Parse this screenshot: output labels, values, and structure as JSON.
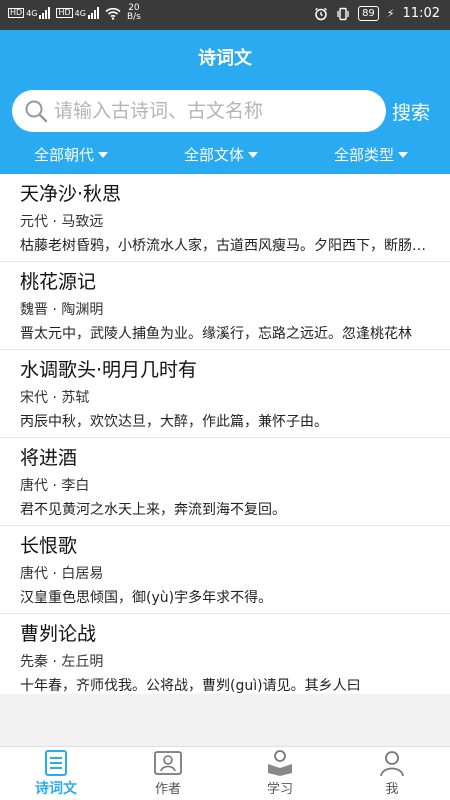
{
  "status_bar": {
    "sim1": "HD",
    "sim2": "HD",
    "net1": "4G",
    "net2": "4G",
    "speed_value": "20",
    "speed_unit": "B/s",
    "battery": "89",
    "time": "11:02"
  },
  "header": {
    "title": "诗词文",
    "search_placeholder": "请输入古诗词、古文名称",
    "search_button": "搜索"
  },
  "filters": [
    {
      "label": "全部朝代"
    },
    {
      "label": "全部文体"
    },
    {
      "label": "全部类型"
    }
  ],
  "items": [
    {
      "title": "天净沙·秋思",
      "meta": "元代 · 马致远",
      "excerpt": "枯藤老树昏鸦，小桥流水人家，古道西风瘦马。夕阳西下，断肠人在天涯。"
    },
    {
      "title": "桃花源记",
      "meta": "魏晋 · 陶渊明",
      "excerpt": "晋太元中，武陵人捕鱼为业。缘溪行，忘路之远近。忽逢桃花林"
    },
    {
      "title": "水调歌头·明月几时有",
      "meta": "宋代 · 苏轼",
      "excerpt": "丙辰中秋，欢饮达旦，大醉，作此篇，兼怀子由。"
    },
    {
      "title": "将进酒",
      "meta": "唐代 · 李白",
      "excerpt": "君不见黄河之水天上来，奔流到海不复回。"
    },
    {
      "title": "长恨歌",
      "meta": "唐代 · 白居易",
      "excerpt": "汉皇重色思倾国，御(yù)宇多年求不得。"
    },
    {
      "title": "曹刿论战",
      "meta": "先秦 · 左丘明",
      "excerpt": "十年春，齐师伐我。公将战，曹刿(guì)请见。其乡人曰"
    }
  ],
  "tabs": [
    {
      "label": "诗词文",
      "icon": "document-icon"
    },
    {
      "label": "作者",
      "icon": "portrait-icon"
    },
    {
      "label": "学习",
      "icon": "reader-icon"
    },
    {
      "label": "我",
      "icon": "person-icon"
    }
  ],
  "colors": {
    "primary": "#2aaaf0",
    "status_bar": "#3a3a3a"
  }
}
